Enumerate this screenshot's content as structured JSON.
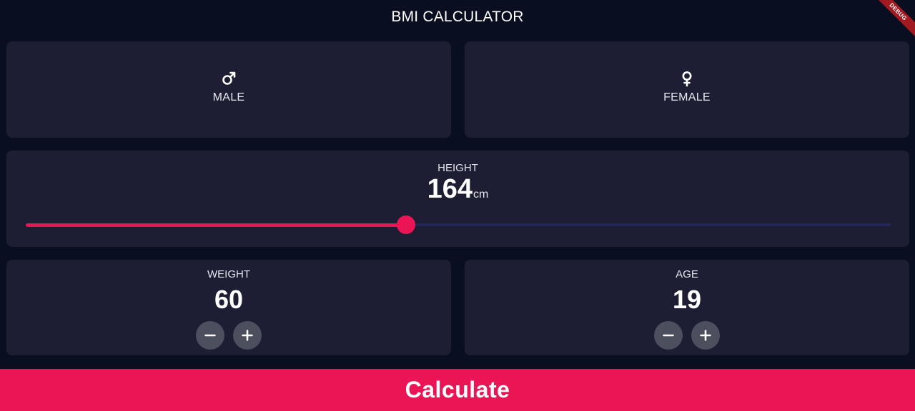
{
  "appbar": {
    "title": "BMI CALCULATOR"
  },
  "gender": {
    "male": {
      "label": "MALE",
      "icon": "male-symbol-icon",
      "glyph": "♂"
    },
    "female": {
      "label": "FEMALE",
      "icon": "female-symbol-icon",
      "glyph": "♀"
    }
  },
  "height": {
    "label": "HEIGHT",
    "value": "164",
    "unit": "cm",
    "slider_fraction": 0.44
  },
  "weight": {
    "label": "WEIGHT",
    "value": "60",
    "decrement_icon": "minus-icon",
    "increment_icon": "plus-icon"
  },
  "age": {
    "label": "AGE",
    "value": "19",
    "decrement_icon": "minus-icon",
    "increment_icon": "plus-icon"
  },
  "calculate": {
    "label": "Calculate"
  },
  "debug_banner": {
    "label": "DEBUG"
  },
  "colors": {
    "background": "#0a0e21",
    "card": "#1d1e33",
    "accent": "#eb1555",
    "slider_inactive": "#24265a",
    "round_button": "#4c4f5e",
    "debug_ribbon": "#a01a20"
  }
}
